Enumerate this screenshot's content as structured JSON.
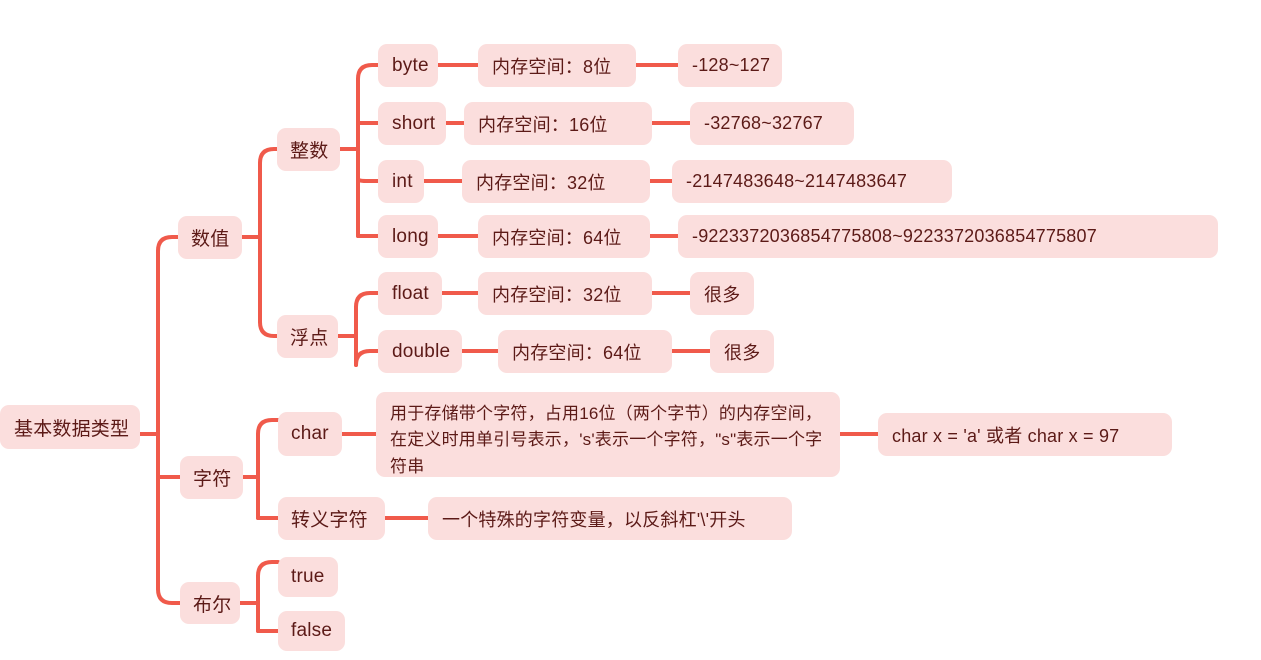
{
  "diagram": {
    "title": "基本数据类型",
    "theme": {
      "background": "#ffffff",
      "node_fill": "#fbdedd",
      "node_text": "#5c1a17",
      "link_color": "#f05a4b"
    },
    "root": {
      "label": "基本数据类型"
    },
    "branches": [
      {
        "label": "数值",
        "children": [
          {
            "label": "整数",
            "children": [
              {
                "label": "byte",
                "memory": "内存空间：8位",
                "range": "-128~127"
              },
              {
                "label": "short",
                "memory": "内存空间：16位",
                "range": "-32768~32767"
              },
              {
                "label": "int",
                "memory": "内存空间：32位",
                "range": "-2147483648~2147483647"
              },
              {
                "label": "long",
                "memory": "内存空间：64位",
                "range": "-9223372036854775808~9223372036854775807"
              }
            ]
          },
          {
            "label": "浮点",
            "children": [
              {
                "label": "float",
                "memory": "内存空间：32位",
                "range": "很多"
              },
              {
                "label": "double",
                "memory": "内存空间：64位",
                "range": "很多"
              }
            ]
          }
        ]
      },
      {
        "label": "字符",
        "children": [
          {
            "label": "char",
            "description": "用于存储带个字符，占用16位（两个字节）的内存空间，在定义时用单引号表示，'s'表示一个字符，\"s\"表示一个字符串",
            "example": "char x = 'a'  或者 char x = 97"
          },
          {
            "label": "转义字符",
            "description": "一个特殊的字符变量，以反斜杠'\\'开头"
          }
        ]
      },
      {
        "label": "布尔",
        "children": [
          {
            "label": "true"
          },
          {
            "label": "false"
          }
        ]
      }
    ]
  }
}
